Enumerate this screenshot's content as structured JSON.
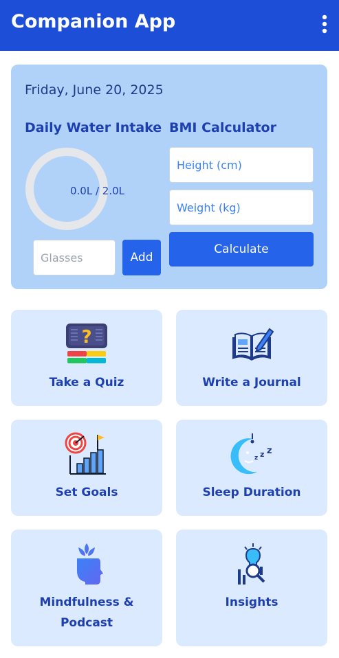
{
  "app": {
    "title": "Companion App",
    "menu_icon": "more-vert-icon"
  },
  "summary": {
    "date": "Friday, June 20, 2025",
    "water": {
      "title": "Daily Water Intake",
      "display": "0.0L / 2.0L",
      "consumed_liters": 0.0,
      "goal_liters": 2.0,
      "glasses_placeholder": "Glasses",
      "add_label": "Add"
    },
    "bmi": {
      "title": "BMI Calculator",
      "height_placeholder": "Height (cm)",
      "weight_placeholder": "Weight (kg)",
      "calculate_label": "Calculate"
    }
  },
  "features": [
    {
      "label": "Take a Quiz",
      "icon": "quiz-icon"
    },
    {
      "label": "Write a Journal",
      "icon": "journal-icon"
    },
    {
      "label": "Set Goals",
      "icon": "goals-icon"
    },
    {
      "label": "Sleep Duration",
      "icon": "sleep-icon"
    },
    {
      "label": "Mindfulness & Podcast",
      "label_line1": "Mindfulness &",
      "label_line2": "Podcast",
      "icon": "mindfulness-icon"
    },
    {
      "label": "Insights",
      "icon": "insights-icon"
    }
  ],
  "colors": {
    "appbar": "#1d4ed8",
    "card": "#b0d1f8",
    "tile": "#dbeafe",
    "primary_button": "#2563eb",
    "text_accent": "#1e40af"
  }
}
